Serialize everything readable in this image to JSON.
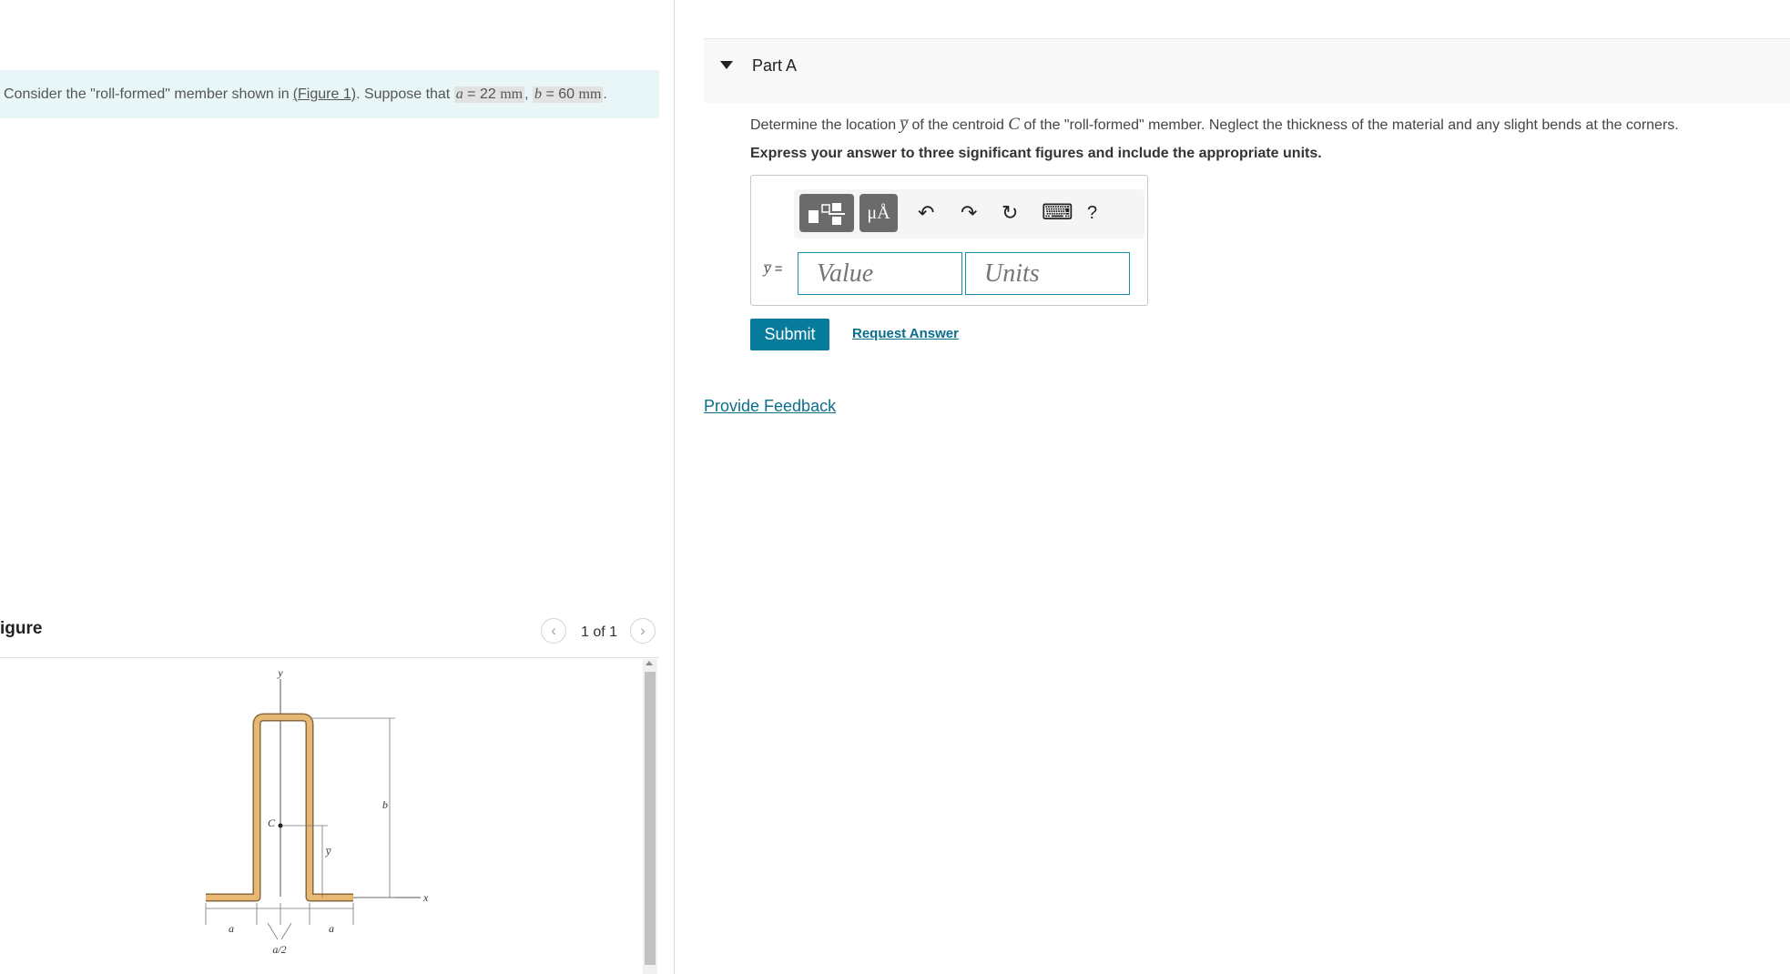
{
  "problem": {
    "prefix": "Consider the \"roll-formed\" member shown in",
    "figure_link": "(Figure 1)",
    "middle": ". Suppose that",
    "a_symbol": "a",
    "a_value": "= 22",
    "a_unit": "mm",
    "comma": ",",
    "b_symbol": "b",
    "b_value": "= 60",
    "b_unit": "mm",
    "suffix": "."
  },
  "figure": {
    "title": "igure",
    "counter": "1 of 1",
    "prev_icon": "chevron-left-icon",
    "next_icon": "chevron-right-icon",
    "labels": {
      "y": "y",
      "x": "x",
      "c": "C",
      "b": "b",
      "ybar": "y̅",
      "a_left": "a",
      "a_right": "a",
      "a_half": "a/2"
    },
    "colors": {
      "member_fill": "#e7b874",
      "member_edge": "#8a6a3c"
    }
  },
  "part": {
    "title": "Part A",
    "question_start": "Determine the location",
    "question_symbol": "y̅",
    "question_mid": "of the centroid",
    "question_c": "C",
    "question_end": "of the \"roll-formed\" member. Neglect the thickness of the material and any slight bends at the corners.",
    "instruction": "Express your answer to three significant figures and include the appropriate units."
  },
  "answer": {
    "label_symbol": "y̅",
    "label_eq": "=",
    "value_placeholder": "Value",
    "units_placeholder": "Units",
    "toolbar": {
      "templates_icon": "templates-icon",
      "units_label": "μÅ",
      "undo": "↶",
      "redo": "↷",
      "reset": "↻",
      "keyboard": "⌨",
      "help": "?"
    },
    "submit_label": "Submit",
    "request_label": "Request Answer"
  },
  "feedback_label": "Provide Feedback",
  "colors": {
    "accent": "#077b9b",
    "link": "#0a6e8c",
    "problem_bg": "#e8f6f8"
  }
}
